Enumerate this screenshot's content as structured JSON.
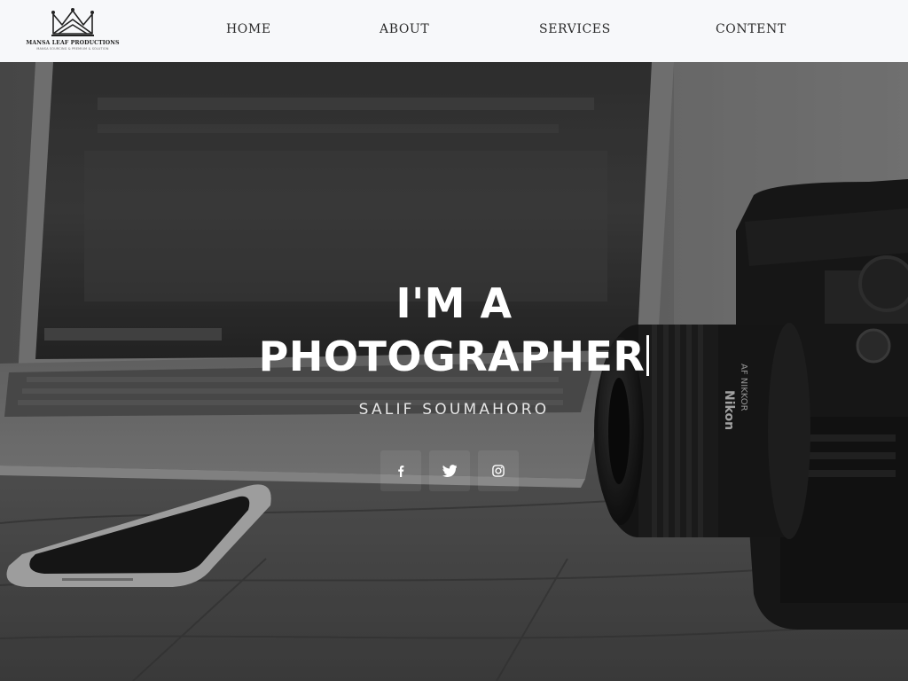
{
  "brand": {
    "name": "MANSA LEAF PRODUCTIONS",
    "tagline": "MANSA SOURCING & PREMIUM & SOLUTION"
  },
  "nav": {
    "items": [
      {
        "label": "HOME"
      },
      {
        "label": "ABOUT"
      },
      {
        "label": "SERVICES"
      },
      {
        "label": "CONTENT"
      }
    ]
  },
  "hero": {
    "line1": "I'M A",
    "line2": "PHOTOGRAPHER",
    "name": "SALIF SOUMAHORO"
  },
  "social": [
    {
      "icon": "facebook-icon"
    },
    {
      "icon": "twitter-icon"
    },
    {
      "icon": "instagram-icon"
    }
  ],
  "colors": {
    "navbar_bg": "#f7f8fa",
    "nav_text": "#2b2b2b",
    "hero_text": "#ffffff"
  }
}
